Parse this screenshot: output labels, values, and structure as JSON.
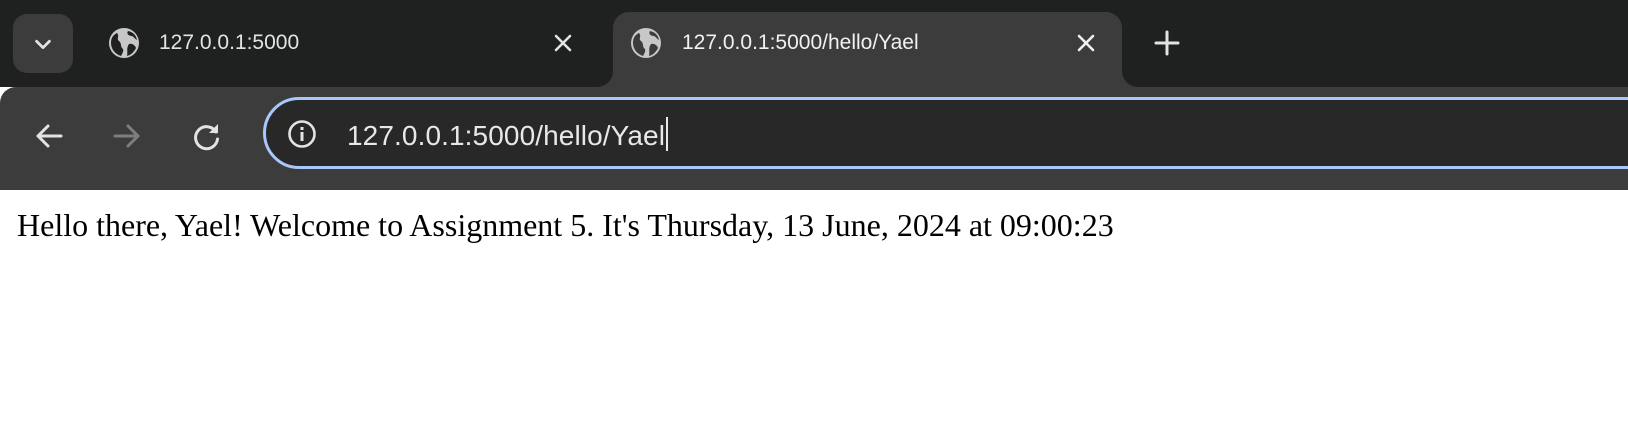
{
  "tabs": [
    {
      "title": "127.0.0.1:5000",
      "active": false
    },
    {
      "title": "127.0.0.1:5000/hello/Yael",
      "active": true
    }
  ],
  "toolbar": {
    "url": "127.0.0.1:5000/hello/Yael"
  },
  "page": {
    "message": "Hello there, Yael! Welcome to Assignment 5. It's Thursday, 13 June, 2024 at 09:00:23"
  },
  "colors": {
    "tabstrip_bg": "#1f2020",
    "toolbar_bg": "#3c3c3c",
    "omnibox_bg": "#282828",
    "omnibox_focus_ring": "#a8c7fa",
    "text_light": "#e3e3e3"
  },
  "icons": {
    "tab_search": "chevron-down-icon",
    "favicon": "globe-icon",
    "close": "close-icon",
    "new_tab": "plus-icon",
    "back": "arrow-left-icon",
    "forward": "arrow-right-icon",
    "reload": "reload-icon",
    "site_info": "info-icon"
  }
}
